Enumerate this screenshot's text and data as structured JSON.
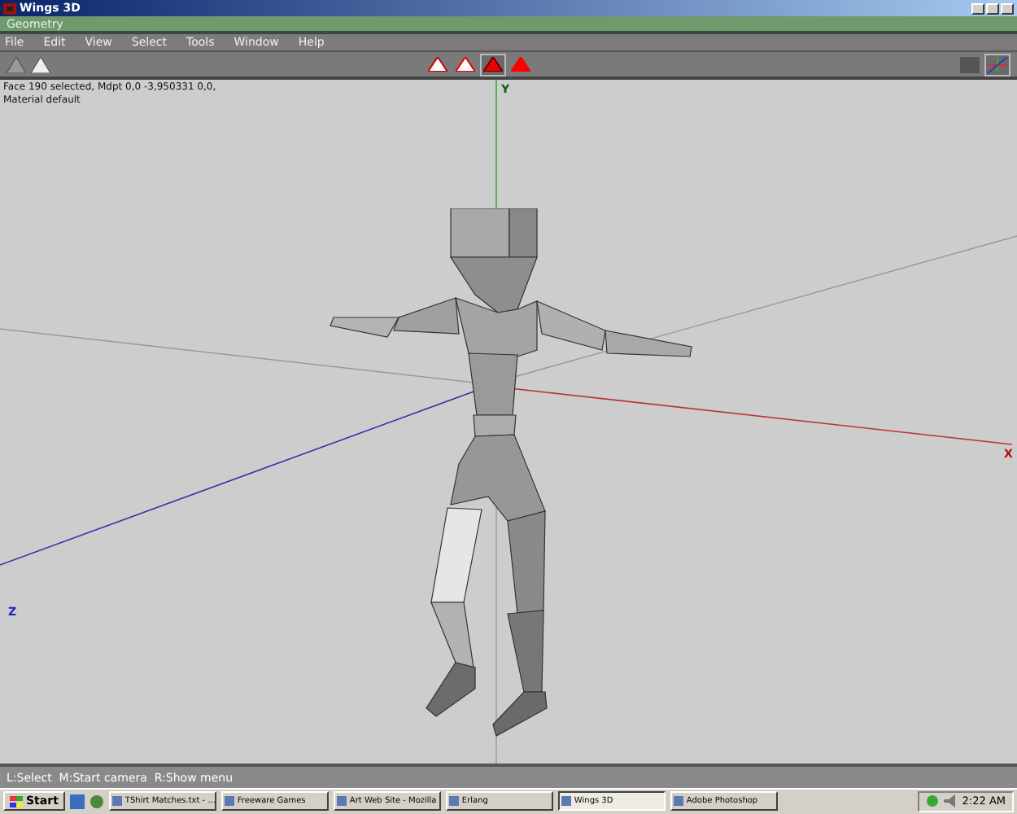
{
  "window": {
    "title": "Wings 3D"
  },
  "geometry_bar": {
    "title": "Geometry"
  },
  "menu": [
    "File",
    "Edit",
    "View",
    "Select",
    "Tools",
    "Window",
    "Help"
  ],
  "select_modes": [
    {
      "kind": "vertex",
      "selected": false
    },
    {
      "kind": "edge",
      "selected": false
    },
    {
      "kind": "face",
      "selected": true
    },
    {
      "kind": "body",
      "selected": false
    }
  ],
  "view_buttons": [
    {
      "kind": "smooth",
      "selected": false
    },
    {
      "kind": "axes",
      "selected": true
    }
  ],
  "info": [
    "Face 190 selected, Mdpt 0,0 -3,950331 0,0,",
    "Material default"
  ],
  "axis_labels": [
    {
      "kind": "y",
      "label": "Y"
    },
    {
      "kind": "x",
      "label": "X"
    },
    {
      "kind": "z",
      "label": "Z"
    }
  ],
  "status_bar": "L:Select  M:Start camera  R:Show menu",
  "taskbar": {
    "start": "Start",
    "items": [
      {
        "label": "TShirt Matches.txt - ...",
        "selected": false
      },
      {
        "label": "Freeware Games",
        "selected": false
      },
      {
        "label": "Art Web Site - Mozilla",
        "selected": false
      },
      {
        "label": "Erlang",
        "selected": false
      },
      {
        "label": "Wings 3D",
        "selected": true
      },
      {
        "label": "Adobe Photoshop",
        "selected": false
      }
    ],
    "clock": "2:22 AM"
  }
}
